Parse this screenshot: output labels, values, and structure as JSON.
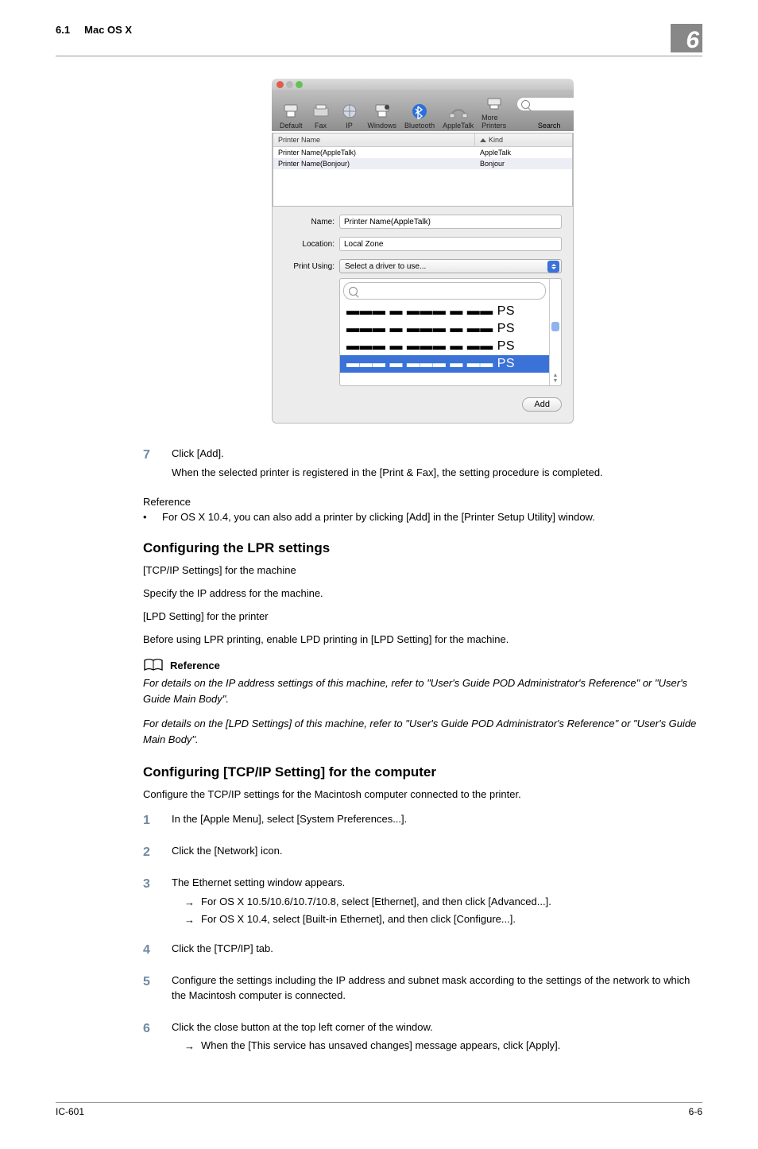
{
  "header": {
    "section_no": "6.1",
    "section_title": "Mac OS X",
    "chapter_no": "6"
  },
  "screenshot": {
    "toolbar": {
      "items": [
        "Default",
        "Fax",
        "IP",
        "Windows",
        "Bluetooth",
        "AppleTalk",
        "More Printers"
      ],
      "search_label": "Search"
    },
    "list": {
      "col_name": "Printer Name",
      "col_kind": "Kind",
      "rows": [
        {
          "name": "Printer Name(AppleTalk)",
          "kind": "AppleTalk"
        },
        {
          "name": "Printer Name(Bonjour)",
          "kind": "Bonjour"
        }
      ]
    },
    "fields": {
      "name_label": "Name:",
      "name_value": "Printer Name(AppleTalk)",
      "location_label": "Location:",
      "location_value": "Local Zone",
      "printusing_label": "Print Using:",
      "printusing_value": "Select a driver to use..."
    },
    "drivers": {
      "items": [
        "▬▬▬ ▬ ▬▬▬ ▬ ▬▬ PS",
        "▬▬▬ ▬ ▬▬▬ ▬ ▬▬ PS",
        "▬▬▬ ▬ ▬▬▬ ▬ ▬▬ PS",
        "▬▬▬ ▬ ▬▬▬ ▬ ▬▬ PS"
      ],
      "selected_index": 3
    },
    "add_btn": "Add"
  },
  "step7": {
    "num": "7",
    "line1": "Click [Add].",
    "line2": "When the selected printer is registered in the [Print & Fax], the setting procedure is completed."
  },
  "ref_word": "Reference",
  "bullet1": "For OS X 10.4, you can also add a printer by clicking [Add] in the [Printer Setup Utility] window.",
  "lpr": {
    "heading": "Configuring the LPR settings",
    "p1": "[TCP/IP Settings] for the machine",
    "p2": "Specify the IP address for the machine.",
    "p3": "[LPD Setting] for the printer",
    "p4": "Before using LPR printing, enable LPD printing in [LPD Setting] for the machine."
  },
  "refbox": {
    "title": "Reference",
    "p1": "For details on the IP address settings of this machine, refer to \"User's Guide POD Administrator's Reference\" or \"User's Guide Main Body\".",
    "p2": "For details on the [LPD Settings] of this machine, refer to \"User's Guide POD Administrator's Reference\" or \"User's Guide Main Body\"."
  },
  "tcp": {
    "heading": "Configuring [TCP/IP Setting] for the computer",
    "intro": "Configure the TCP/IP settings for the Macintosh computer connected to the printer.",
    "steps": [
      {
        "num": "1",
        "body": "In the [Apple Menu], select [System Preferences...]."
      },
      {
        "num": "2",
        "body": "Click the [Network] icon."
      },
      {
        "num": "3",
        "body": "The Ethernet setting window appears.",
        "subs": [
          "For OS X 10.5/10.6/10.7/10.8, select [Ethernet], and then click [Advanced...].",
          "For OS X 10.4, select [Built-in Ethernet], and then click [Configure...]."
        ]
      },
      {
        "num": "4",
        "body": "Click the [TCP/IP] tab."
      },
      {
        "num": "5",
        "body": "Configure the settings including the IP address and subnet mask according to the settings of the network to which the Macintosh computer is connected."
      },
      {
        "num": "6",
        "body": "Click the close button at the top left corner of the window.",
        "subs": [
          "When the [This service has unsaved changes] message appears, click [Apply]."
        ]
      }
    ]
  },
  "footer": {
    "left": "IC-601",
    "right": "6-6"
  }
}
